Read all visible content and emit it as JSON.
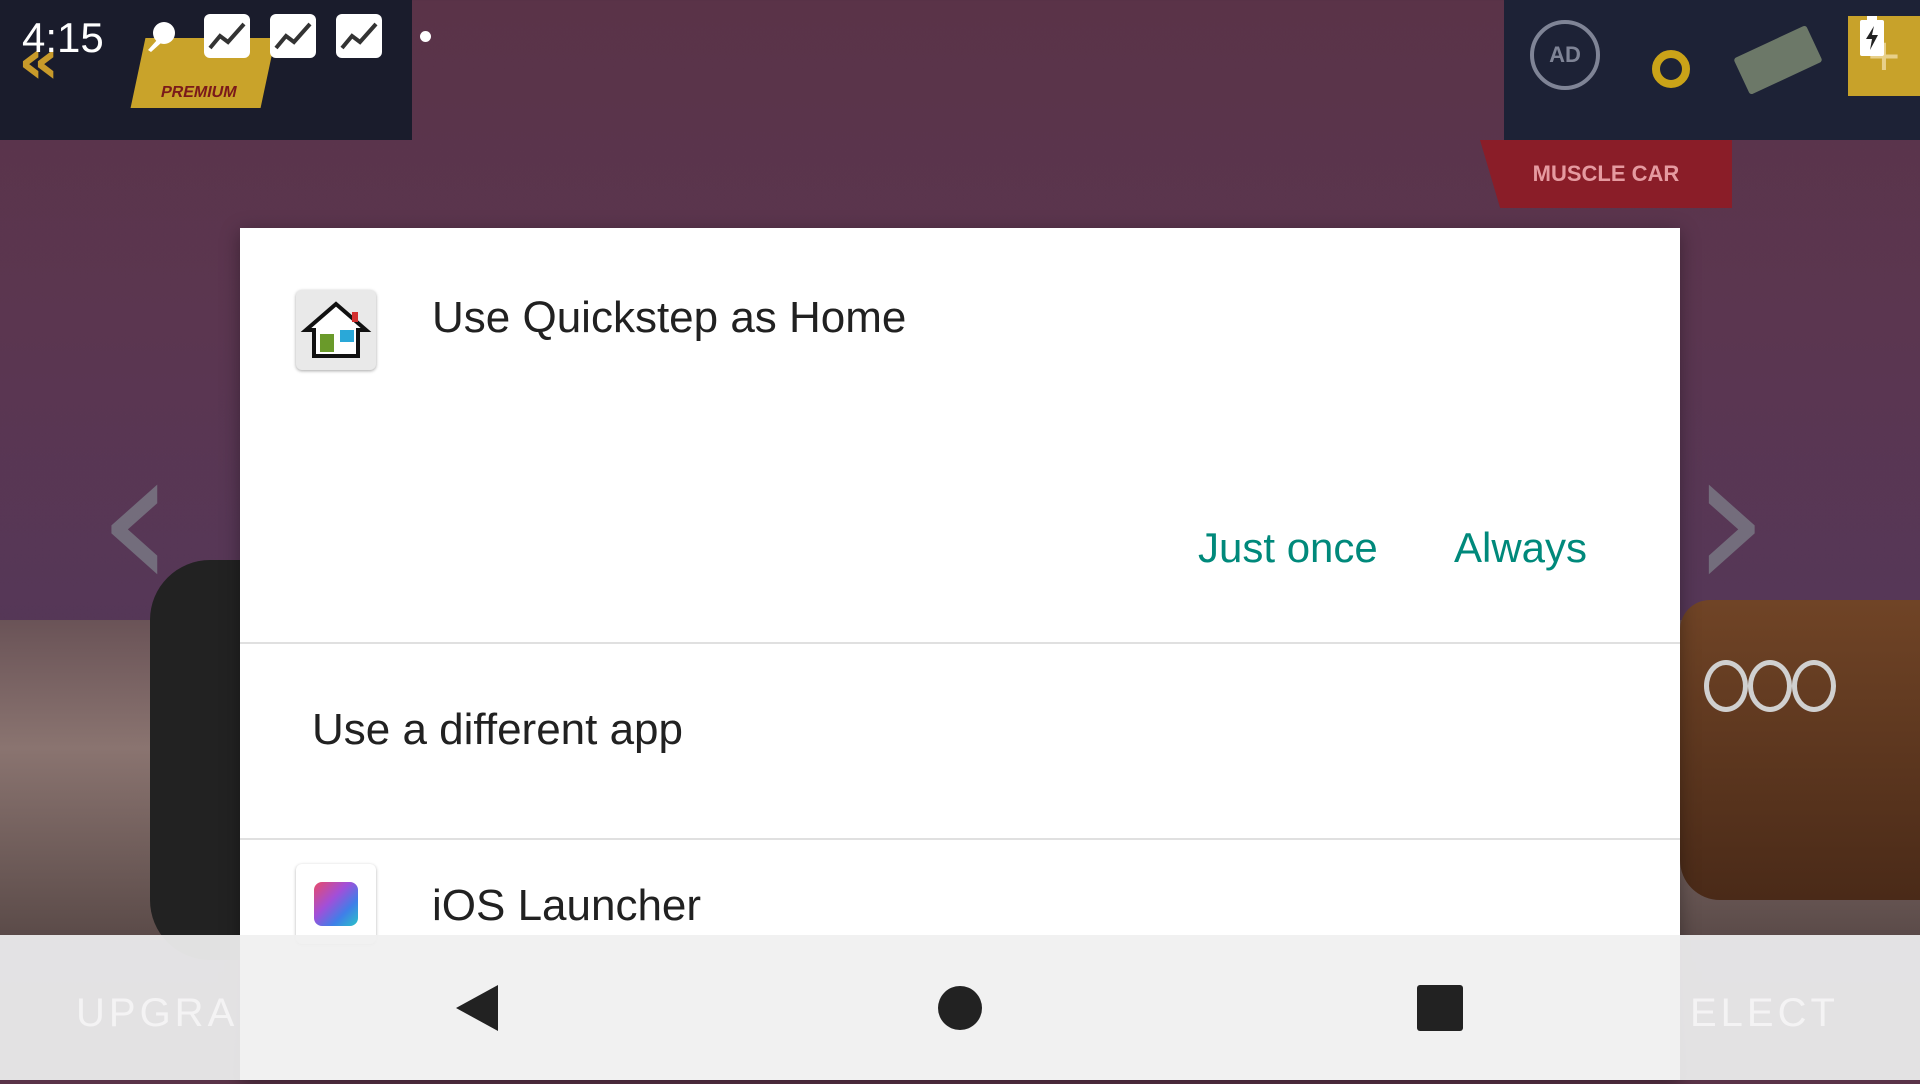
{
  "status_bar": {
    "time": "4:15",
    "icons": [
      "pin-icon",
      "stats-app-icon",
      "stats-app-icon",
      "stats-app-icon",
      "notification-dot-icon",
      "battery-charging-icon"
    ]
  },
  "game": {
    "premium_label": "PREMIUM",
    "ad_label": "AD",
    "category_banner": "MUSCLE CAR",
    "bottom_left_text": "UPGRA",
    "bottom_right_text": "ELECT"
  },
  "dialog": {
    "title": "Use Quickstep as Home",
    "title_icon": "home-launcher-icon",
    "buttons": {
      "just_once": "Just once",
      "always": "Always"
    },
    "other_header": "Use a different app",
    "apps": [
      {
        "label": "iOS Launcher",
        "icon": "ios-launcher-icon"
      }
    ]
  },
  "nav": {
    "icons": [
      "back-icon",
      "home-icon",
      "recents-icon"
    ]
  },
  "colors": {
    "accent": "#00897b",
    "dialog_bg": "#ffffff",
    "text_primary": "#212121"
  }
}
